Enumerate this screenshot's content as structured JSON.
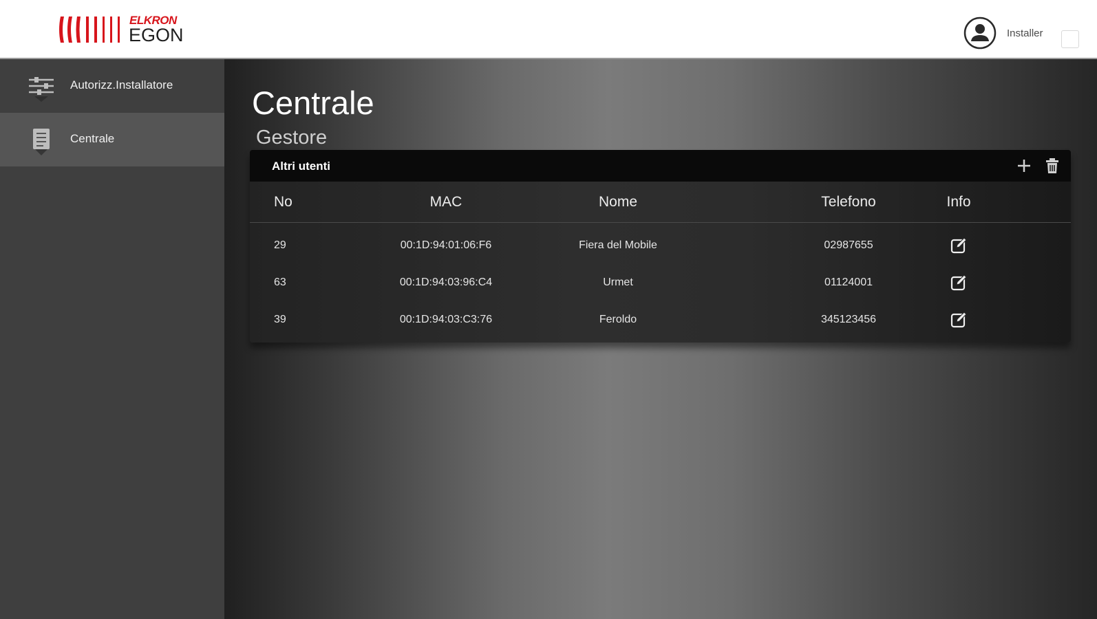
{
  "header": {
    "logo_brand_top": "ELKRON",
    "logo_brand_bottom": "EGON",
    "user_label": "Installer"
  },
  "sidebar": {
    "items": [
      {
        "label": "Autorizz.Installatore",
        "icon": "sliders-icon",
        "active": false
      },
      {
        "label": "Centrale",
        "icon": "document-icon",
        "active": true
      }
    ]
  },
  "main": {
    "title": "Centrale",
    "subtitle": "Gestore",
    "card": {
      "title": "Altri utenti",
      "columns": [
        "No",
        "MAC",
        "Nome",
        "Telefono",
        "Info"
      ],
      "rows": [
        {
          "no": "29",
          "mac": "00:1D:94:01:06:F6",
          "nome": "Fiera del Mobile",
          "telefono": "02987655"
        },
        {
          "no": "63",
          "mac": "00:1D:94:03:96:C4",
          "nome": "Urmet",
          "telefono": "01124001"
        },
        {
          "no": "39",
          "mac": "00:1D:94:03:C3:76",
          "nome": "Feroldo",
          "telefono": "345123456"
        }
      ]
    }
  },
  "colors": {
    "brand_red": "#d7141b",
    "sidebar_bg": "#3f3f3f",
    "sidebar_active": "#555555",
    "card_header": "#0a0a0a"
  }
}
